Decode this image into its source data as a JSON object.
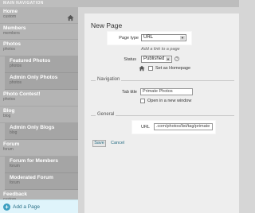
{
  "header": {
    "title": "MAIN NAVIGATION"
  },
  "sidebar": {
    "items": [
      {
        "label": "Home",
        "sub": "custom"
      },
      {
        "label": "Members",
        "sub": "members"
      },
      {
        "label": "Photos",
        "sub": "photos"
      },
      {
        "label": "Featured Photos",
        "sub": "photos"
      },
      {
        "label": "Admin Only Photos",
        "sub": "photos"
      },
      {
        "label": "Photo Contest!",
        "sub": "photos"
      },
      {
        "label": "Blog",
        "sub": "blog"
      },
      {
        "label": "Admin Only Blogs",
        "sub": "blog"
      },
      {
        "label": "Forum",
        "sub": "forum"
      },
      {
        "label": "Forum for Members",
        "sub": "forum"
      },
      {
        "label": "Moderated Forum",
        "sub": "forum"
      },
      {
        "label": "Feedback",
        "sub": "custom"
      }
    ],
    "add_page_label": "Add a Page"
  },
  "form": {
    "title": "New Page",
    "page_type_label": "Page type",
    "page_type_value": "URL",
    "hint": "Add a link to a page",
    "status_label": "Status",
    "status_value": "Published",
    "homepage_label": "Set as Homepage",
    "navigation_heading": "Navigation",
    "tab_title_label": "Tab title",
    "tab_title_value": "Primate Photos",
    "new_window_label": "Open in a new window",
    "general_heading": "General",
    "url_label": "URL",
    "url_value": ".com/photos/list/tag/primate",
    "save_label": "Save",
    "cancel_label": "Cancel"
  }
}
